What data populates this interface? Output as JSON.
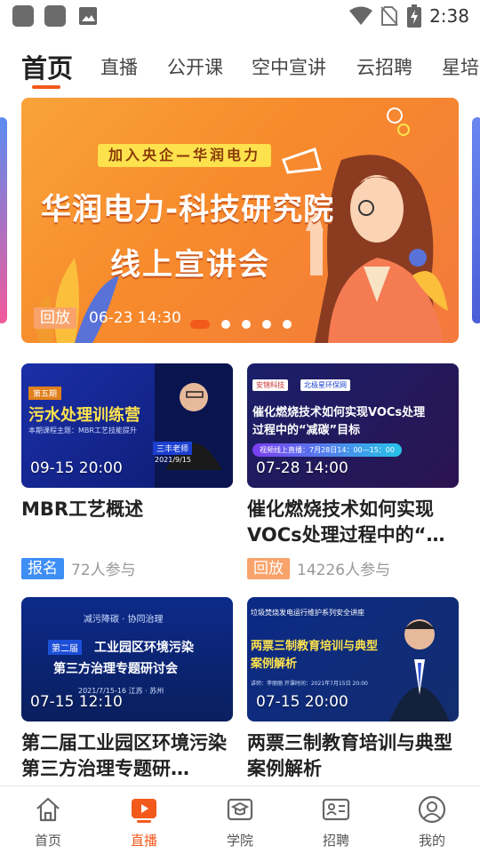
{
  "status_bar": {
    "time": "2:38",
    "icons": [
      "notification-icon",
      "notification-icon",
      "image-icon",
      "wifi-icon",
      "no-sim-icon",
      "battery-charging-icon"
    ]
  },
  "tabs": [
    {
      "label": "首页",
      "active": true
    },
    {
      "label": "直播",
      "active": false
    },
    {
      "label": "公开课",
      "active": false
    },
    {
      "label": "空中宣讲",
      "active": false
    },
    {
      "label": "云招聘",
      "active": false
    },
    {
      "label": "星培",
      "active": false
    }
  ],
  "banner": {
    "tag": "加入央企—华润电力",
    "title": "华润电力-科技研究院",
    "subtitle": "线上宣讲会",
    "badge": "回放",
    "time": "06-23 14:30",
    "dot_count": 5,
    "active_dot": 0
  },
  "cards": [
    {
      "thumb_time": "09-15 20:00",
      "title": "MBR工艺概述",
      "badge": "报名",
      "badge_type": "signup",
      "count": "72人参与"
    },
    {
      "thumb_time": "07-28 14:00",
      "title": "催化燃烧技术如何实现VOCs处理过程中的“…",
      "badge": "回放",
      "badge_type": "replay",
      "count": "14226人参与"
    },
    {
      "thumb_time": "07-15 12:10",
      "title": "第二届工业园区环境污染第三方治理专题研…",
      "badge": "",
      "badge_type": "",
      "count": ""
    },
    {
      "thumb_time": "07-15 20:00",
      "title": "两票三制教育培训与典型案例解析",
      "badge": "",
      "badge_type": "",
      "count": ""
    }
  ],
  "thumb_texts": {
    "c1_episode": "第五期",
    "c1_heading": "污水处理训练营",
    "c1_sub": "本期课程主题：MBR工艺技能提升",
    "c1_name": "三丰老师",
    "c1_date": "2021/9/15",
    "c2_logo_a": "安锦科技",
    "c2_logo_b": "北极星环保网",
    "c2_heading_1": "催化燃烧技术如何实现VOCs处理",
    "c2_heading_2": "过程中的“减碳”目标",
    "c2_pill": "视频线上直播：7月28日14：00—15：00",
    "c3_top": "减污降碳 · 协同治理",
    "c3_tag": "第二届",
    "c3_heading_1": "工业园区环境污染",
    "c3_heading_2": "第三方治理专题研讨会",
    "c3_foot": "2021/7/15-16   江苏 · 苏州",
    "c4_top": "垃圾焚烧发电运行维护系列安全讲座",
    "c4_heading_1": "两票三制教育培训与典型",
    "c4_heading_2": "案例解析",
    "c4_foot": "讲师：李丽丽    开课时间：2021年7月15日 20:00"
  },
  "bottom_nav": [
    {
      "label": "首页",
      "icon": "home-icon",
      "active": false
    },
    {
      "label": "直播",
      "icon": "live-play-icon",
      "active": true
    },
    {
      "label": "学院",
      "icon": "academy-icon",
      "active": false
    },
    {
      "label": "招聘",
      "icon": "recruit-card-icon",
      "active": false
    },
    {
      "label": "我的",
      "icon": "profile-icon",
      "active": false
    }
  ],
  "colors": {
    "accent": "#f4591c",
    "replay_badge": "#f8a36b",
    "signup_badge": "#3d8ef5"
  }
}
